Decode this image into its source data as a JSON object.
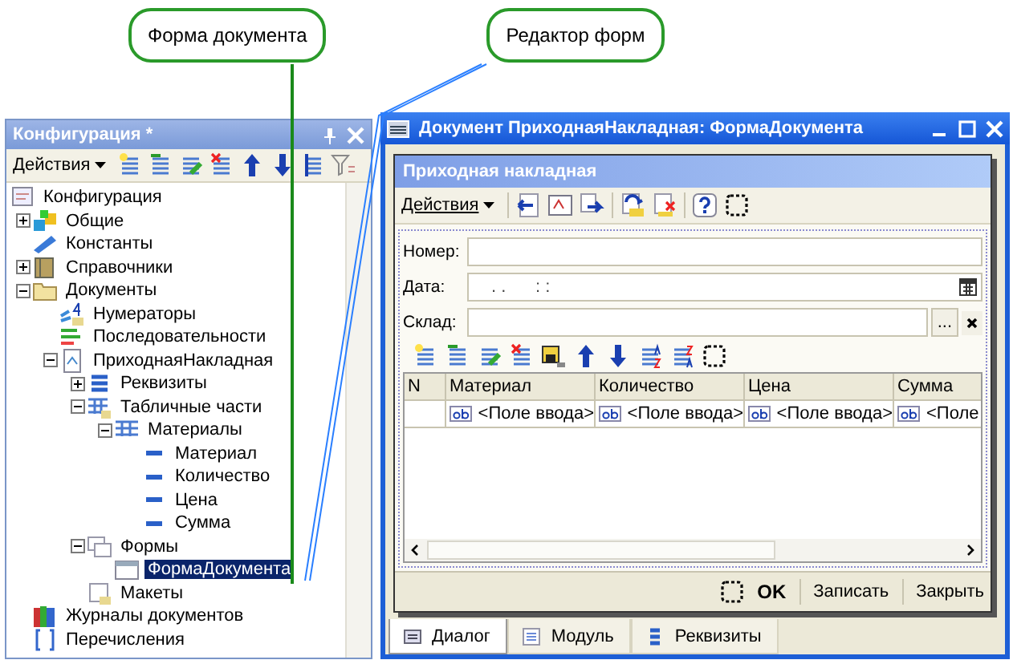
{
  "callouts": [
    {
      "text": "Форма документа"
    },
    {
      "text": "Редактор форм"
    }
  ],
  "config_panel": {
    "title": "Конфигурация *",
    "actions": "Действия",
    "tree": [
      {
        "label": "Конфигурация",
        "kind": "root",
        "selected": false,
        "children": [
          {
            "label": "Общие",
            "kind": "common",
            "expanded": false,
            "selected": false
          },
          {
            "label": "Константы",
            "kind": "constant",
            "selected": false
          },
          {
            "label": "Справочники",
            "kind": "catalog",
            "expanded": false,
            "selected": false
          },
          {
            "label": "Документы",
            "kind": "folder",
            "expanded": true,
            "selected": false,
            "children": [
              {
                "label": "Нумераторы",
                "kind": "numerator",
                "selected": false
              },
              {
                "label": "Последовательности",
                "kind": "sequence",
                "selected": false
              },
              {
                "label": "ПриходнаяНакладная",
                "kind": "document",
                "expanded": true,
                "selected": false,
                "children": [
                  {
                    "label": "Реквизиты",
                    "kind": "attributes",
                    "expanded": false,
                    "selected": false
                  },
                  {
                    "label": "Табличные части",
                    "kind": "tables",
                    "expanded": true,
                    "selected": false,
                    "children": [
                      {
                        "label": "Материалы",
                        "kind": "table",
                        "expanded": true,
                        "selected": false,
                        "children": [
                          {
                            "label": "Материал",
                            "kind": "attribute",
                            "selected": false
                          },
                          {
                            "label": "Количество",
                            "kind": "attribute",
                            "selected": false
                          },
                          {
                            "label": "Цена",
                            "kind": "attribute",
                            "selected": false
                          },
                          {
                            "label": "Сумма",
                            "kind": "attribute",
                            "selected": false
                          }
                        ]
                      }
                    ]
                  },
                  {
                    "label": "Формы",
                    "kind": "forms",
                    "expanded": true,
                    "selected": false,
                    "children": [
                      {
                        "label": "ФормаДокумента",
                        "kind": "form",
                        "selected": true
                      }
                    ]
                  },
                  {
                    "label": "Макеты",
                    "kind": "layouts",
                    "selected": false
                  }
                ]
              }
            ]
          },
          {
            "label": "Журналы документов",
            "kind": "journal",
            "selected": false
          },
          {
            "label": "Перечисления",
            "kind": "enum",
            "selected": false
          }
        ]
      }
    ]
  },
  "editor_window": {
    "title": "Документ ПриходнаяНакладная: ФормаДокумента",
    "form": {
      "header": "Приходная накладная",
      "actions": "Действия",
      "fields": [
        {
          "label": "Номер:",
          "kind": "text"
        },
        {
          "label": "Дата:",
          "kind": "date",
          "value": ". .      : :"
        },
        {
          "label": "Склад:",
          "kind": "reference",
          "select_button": "..."
        }
      ],
      "table": {
        "columns": [
          "N",
          "Материал",
          "Количество",
          "Цена",
          "Сумма"
        ],
        "rows": [
          [
            "",
            "<Поле ввода>",
            "<Поле ввода>",
            "<Поле ввода>",
            "<Поле"
          ]
        ]
      },
      "buttons": [
        "OK",
        "Записать",
        "Закрыть"
      ]
    },
    "tabs": [
      {
        "label": "Диалог",
        "selected": true
      },
      {
        "label": "Модуль",
        "selected": false
      },
      {
        "label": "Реквизиты",
        "selected": false
      }
    ]
  }
}
